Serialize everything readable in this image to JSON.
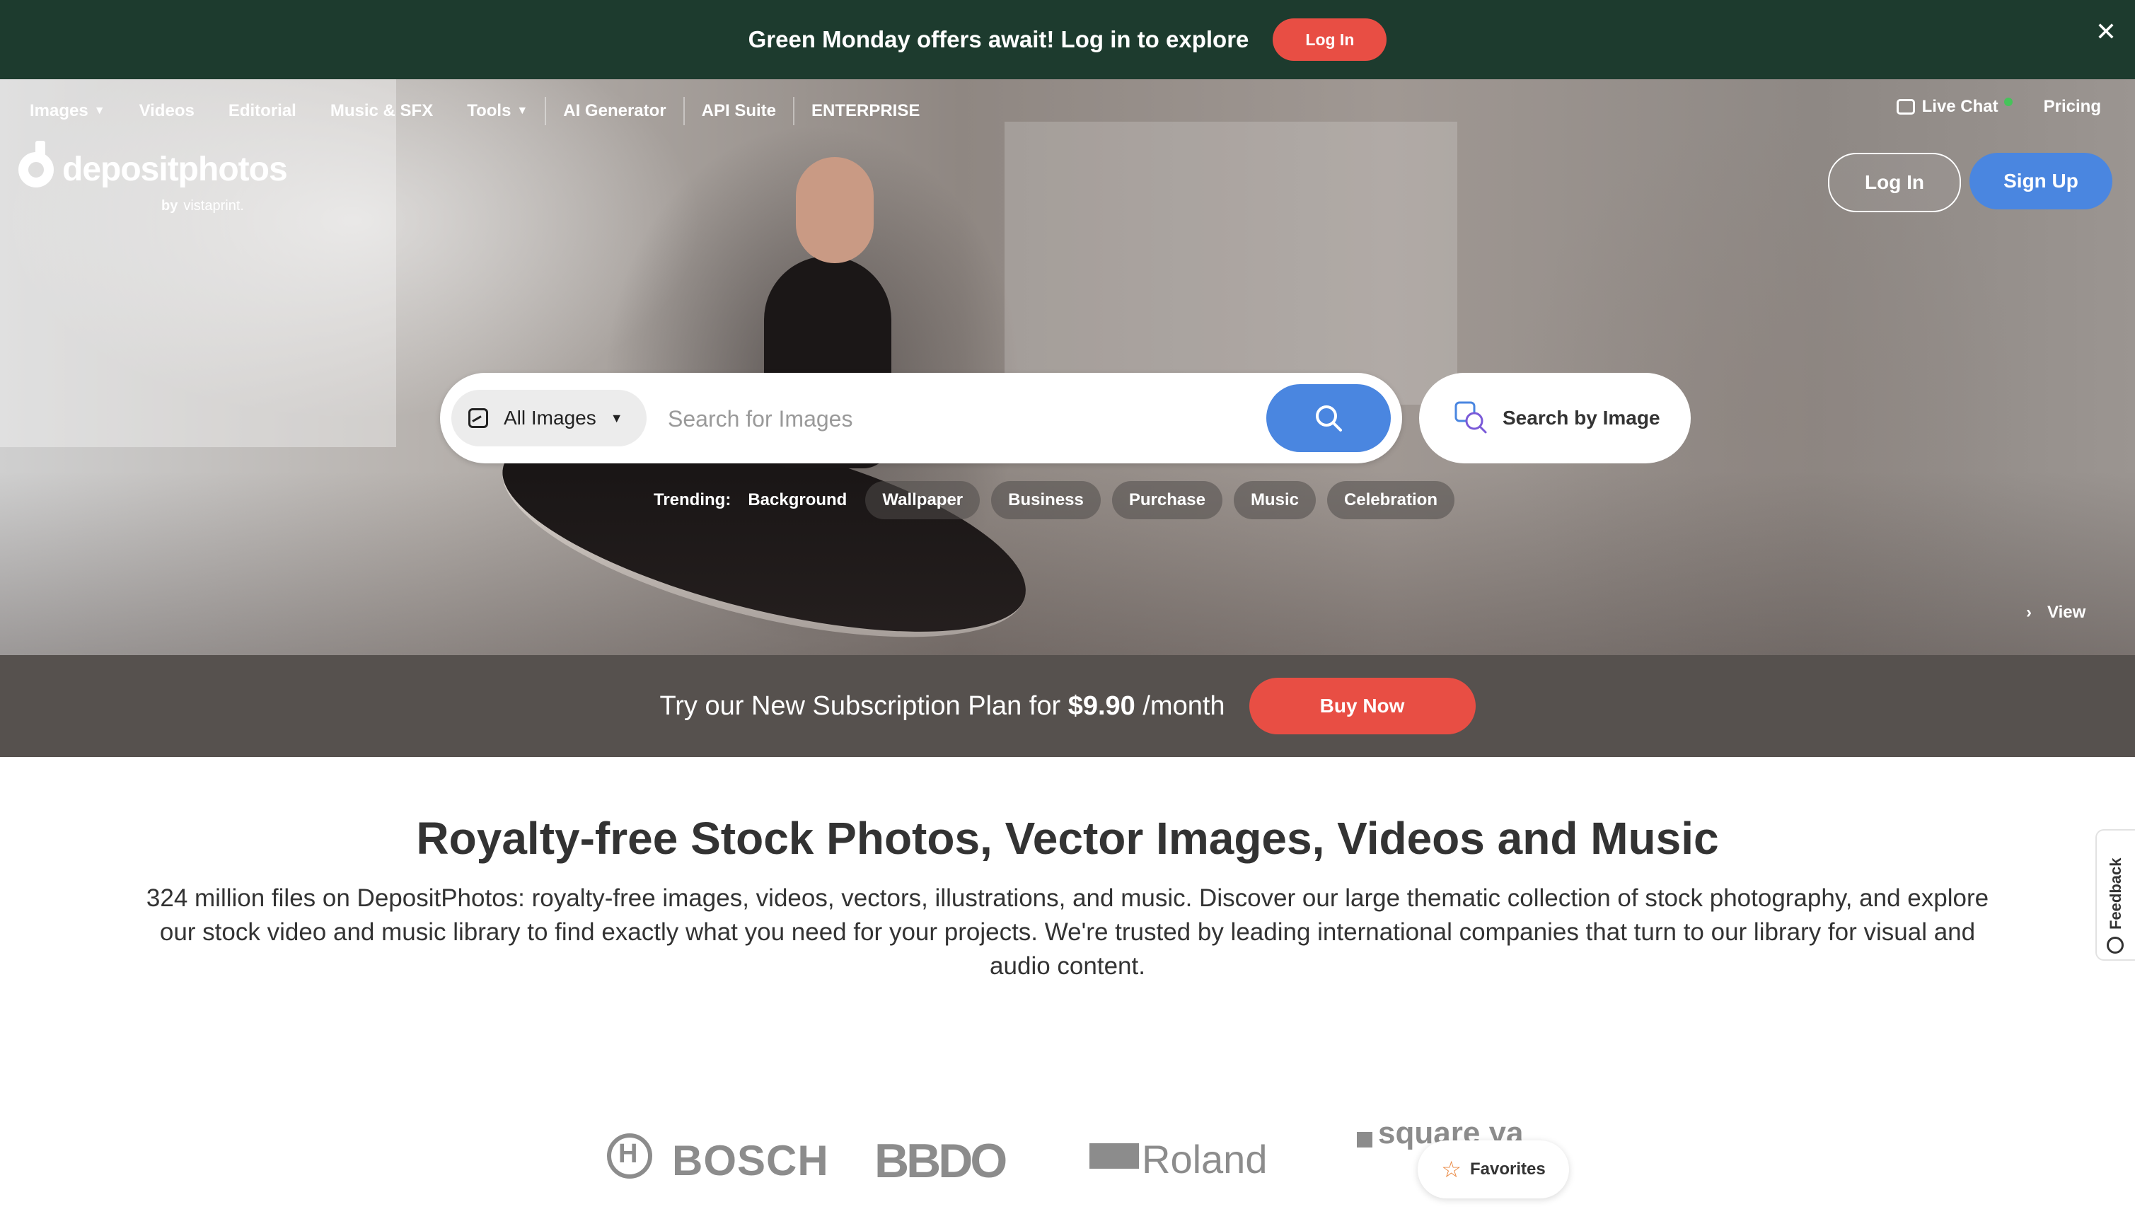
{
  "promo_banner": {
    "text": "Green Monday offers await! Log in to explore",
    "login_label": "Log In",
    "close_glyph": "✕",
    "background": "#1d3b2e",
    "button_color": "#e84e44"
  },
  "nav": {
    "items": [
      {
        "label": "Images",
        "dropdown": true
      },
      {
        "label": "Videos"
      },
      {
        "label": "Editorial"
      },
      {
        "label": "Music & SFX"
      },
      {
        "label": "Tools",
        "dropdown": true
      },
      {
        "label": "AI Generator"
      },
      {
        "label": "API Suite"
      },
      {
        "label": "ENTERPRISE"
      }
    ],
    "live_chat": "Live Chat",
    "pricing": "Pricing"
  },
  "brand": {
    "name": "depositphotos",
    "by": "by",
    "partner": "vistaprint."
  },
  "auth": {
    "login_label": "Log In",
    "signup_label": "Sign Up",
    "accent": "#4a86e0"
  },
  "search": {
    "type_label": "All Images",
    "placeholder": "Search for Images",
    "value": "",
    "by_image_label": "Search by Image",
    "search_icon": "search-icon"
  },
  "trending": {
    "label": "Trending:",
    "tags": [
      "Background",
      "Wallpaper",
      "Business",
      "Purchase",
      "Music",
      "Celebration"
    ]
  },
  "hero": {
    "view_label": "View"
  },
  "subscription": {
    "text_prefix": "Try our New Subscription Plan for",
    "price": "$9.90",
    "period": "/month",
    "button_label": "Buy Now"
  },
  "main": {
    "headline": "Royalty-free Stock Photos, Vector Images, Videos and Music",
    "description": "324 million files on DepositPhotos: royalty-free images, videos, vectors, illustrations, and music. Discover our large thematic collection of stock photography, and explore our stock video and music library to find exactly what you need for your projects. We're trusted by leading international companies that turn to our library for visual and audio content."
  },
  "client_logos": [
    "BOSCH",
    "BBDO",
    "Roland",
    "square ya"
  ],
  "favorites": {
    "label": "Favorites",
    "icon": "star-icon"
  },
  "feedback": {
    "label": "Feedback"
  }
}
